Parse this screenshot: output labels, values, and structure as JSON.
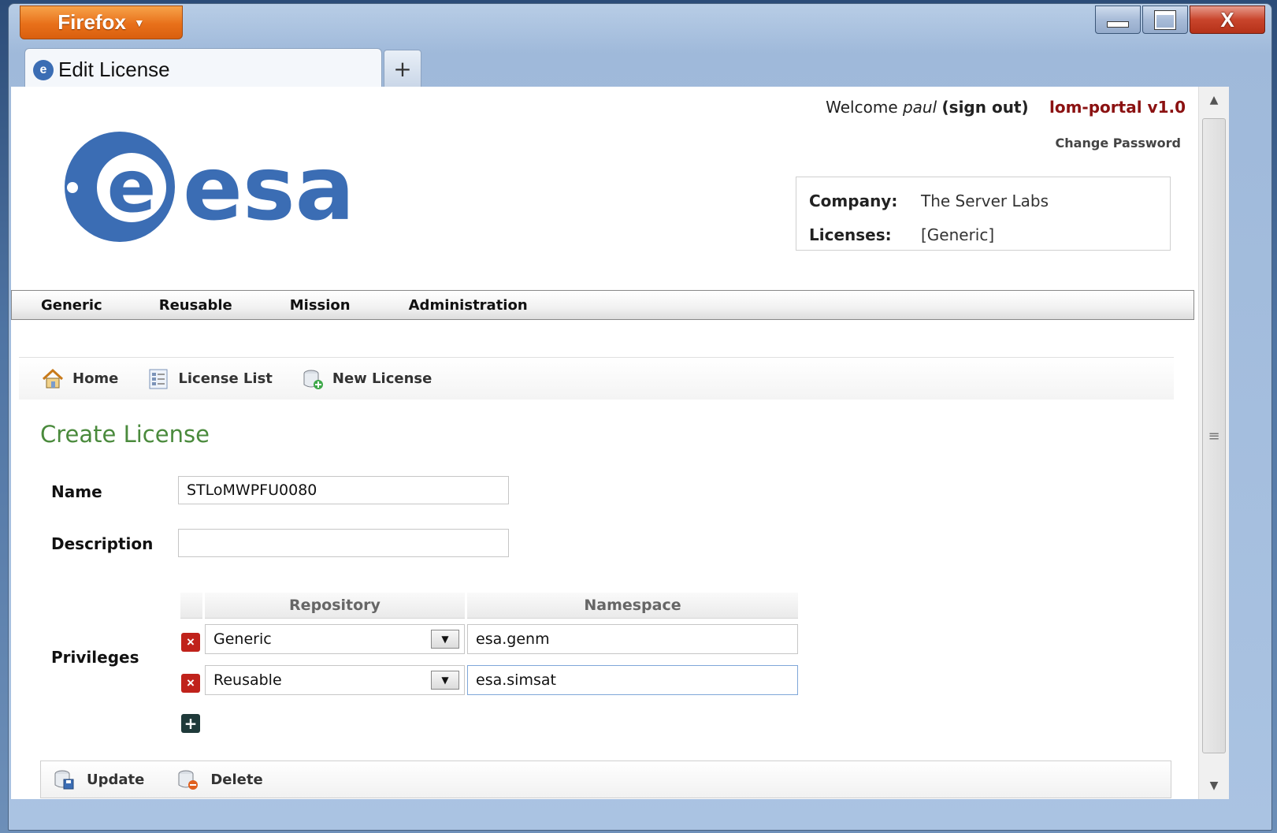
{
  "browser": {
    "app_button": "Firefox",
    "tab_title": "Edit License",
    "new_tab": "+"
  },
  "header": {
    "welcome_prefix": "Welcome",
    "user": "paul",
    "sign_out": "(sign out)",
    "version": "lom-portal v1.0",
    "change_password": "Change Password",
    "logo_text": "esa",
    "company_label": "Company:",
    "company_value": "The Server Labs",
    "licenses_label": "Licenses:",
    "licenses_value": "[Generic]"
  },
  "main_nav": [
    "Generic",
    "Reusable",
    "Mission",
    "Administration"
  ],
  "sub_nav": {
    "home": "Home",
    "license_list": "License List",
    "new_license": "New License"
  },
  "form": {
    "title": "Create License",
    "name_label": "Name",
    "name_value": "STLoMWPFU0080",
    "description_label": "Description",
    "description_value": "",
    "privileges_label": "Privileges",
    "col_repository": "Repository",
    "col_namespace": "Namespace",
    "privileges": [
      {
        "repository": "Generic",
        "namespace": "esa.genm"
      },
      {
        "repository": "Reusable",
        "namespace": "esa.simsat"
      }
    ]
  },
  "actions": {
    "update": "Update",
    "delete": "Delete"
  },
  "colors": {
    "accent_title": "#4a8a3c",
    "version": "#8b1111",
    "esa_blue": "#3b6db4",
    "firefox_orange": "#e8701a"
  }
}
